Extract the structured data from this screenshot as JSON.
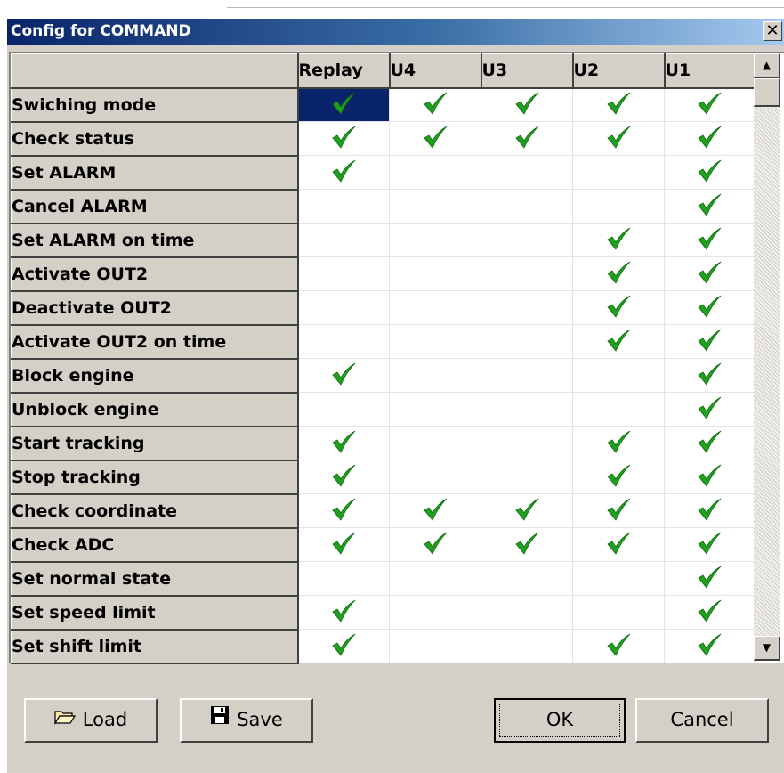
{
  "window": {
    "title": "Config for COMMAND",
    "close_symbol": "✕"
  },
  "grid": {
    "columns": [
      "Replay",
      "U4",
      "U3",
      "U2",
      "U1"
    ],
    "check_icon": "green-checkmark-icon",
    "check_color": "#1fa01f",
    "selected_cell": {
      "row": 0,
      "col": 0
    },
    "rows": [
      {
        "label": "Swiching mode",
        "checks": [
          true,
          true,
          true,
          true,
          true
        ]
      },
      {
        "label": "Check status",
        "checks": [
          true,
          true,
          true,
          true,
          true
        ]
      },
      {
        "label": "Set ALARM",
        "checks": [
          true,
          false,
          false,
          false,
          true
        ]
      },
      {
        "label": "Cancel ALARM",
        "checks": [
          false,
          false,
          false,
          false,
          true
        ]
      },
      {
        "label": "Set ALARM on time",
        "checks": [
          false,
          false,
          false,
          true,
          true
        ]
      },
      {
        "label": "Activate OUT2",
        "checks": [
          false,
          false,
          false,
          true,
          true
        ]
      },
      {
        "label": "Deactivate OUT2",
        "checks": [
          false,
          false,
          false,
          true,
          true
        ]
      },
      {
        "label": "Activate OUT2 on time",
        "checks": [
          false,
          false,
          false,
          true,
          true
        ]
      },
      {
        "label": "Block engine",
        "checks": [
          true,
          false,
          false,
          false,
          true
        ]
      },
      {
        "label": "Unblock engine",
        "checks": [
          false,
          false,
          false,
          false,
          true
        ]
      },
      {
        "label": "Start tracking",
        "checks": [
          true,
          false,
          false,
          true,
          true
        ]
      },
      {
        "label": "Stop tracking",
        "checks": [
          true,
          false,
          false,
          true,
          true
        ]
      },
      {
        "label": "Check coordinate",
        "checks": [
          true,
          true,
          true,
          true,
          true
        ]
      },
      {
        "label": "Check ADC",
        "checks": [
          true,
          true,
          true,
          true,
          true
        ]
      },
      {
        "label": "Set normal state",
        "checks": [
          false,
          false,
          false,
          false,
          true
        ]
      },
      {
        "label": "Set speed limit",
        "checks": [
          true,
          false,
          false,
          false,
          true
        ]
      },
      {
        "label": "Set shift limit",
        "checks": [
          true,
          false,
          false,
          true,
          true
        ]
      }
    ]
  },
  "scrollbar": {
    "up_arrow": "▲",
    "down_arrow": "▼"
  },
  "buttons": {
    "load": "Load",
    "load_icon": "folder-open-icon",
    "save": "Save",
    "save_icon": "floppy-disk-icon",
    "ok": "OK",
    "cancel": "Cancel"
  },
  "colors": {
    "title_gradient_start": "#0a246a",
    "title_gradient_end": "#a6caf0",
    "face": "#d4d0c8",
    "selection": "#0a246a"
  }
}
